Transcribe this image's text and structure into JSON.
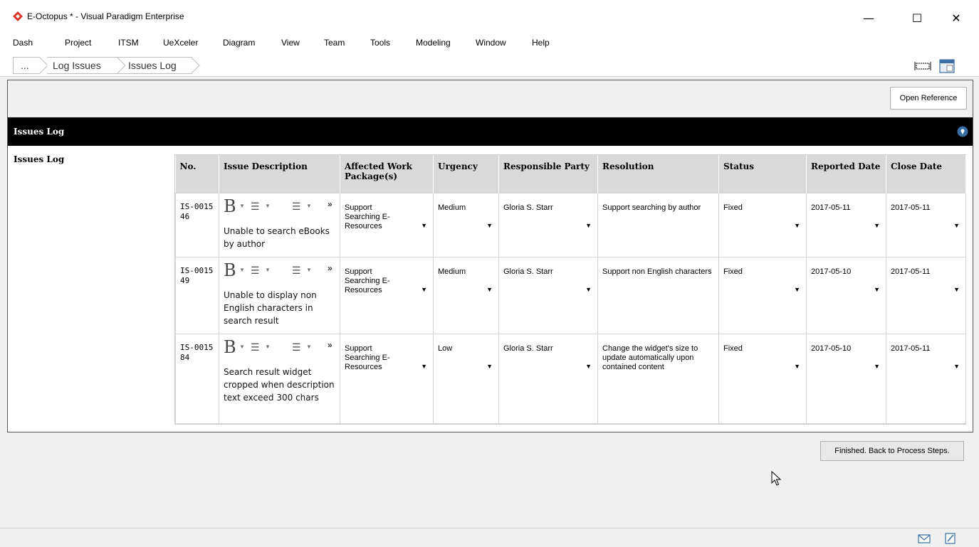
{
  "window": {
    "title": "E-Octopus * - Visual Paradigm Enterprise",
    "controls": {
      "minimize": "—",
      "maximize": "☐",
      "close": "✕"
    }
  },
  "menu": [
    "Dash",
    "Project",
    "ITSM",
    "UeXceler",
    "Diagram",
    "View",
    "Team",
    "Tools",
    "Modeling",
    "Window",
    "Help"
  ],
  "breadcrumb": [
    "...",
    "Log Issues",
    "Issues Log"
  ],
  "toolbar": {
    "open_reference": "Open Reference"
  },
  "section": {
    "title": "Issues Log",
    "side_label": "Issues Log"
  },
  "table": {
    "headers": {
      "no": "No.",
      "description": "Issue Description",
      "affected": "Affected Work Package(s)",
      "urgency": "Urgency",
      "responsible": "Responsible Party",
      "resolution": "Resolution",
      "status": "Status",
      "reported": "Reported Date",
      "close": "Close Date"
    },
    "rows": [
      {
        "no": "IS-0015 46",
        "description": "Unable to search eBooks by author",
        "affected": "Support Searching E-Resources",
        "urgency": "Medium",
        "responsible": "Gloria S. Starr",
        "resolution": "Support searching by author",
        "status": "Fixed",
        "reported": "2017-05-11",
        "close": "2017-05-11"
      },
      {
        "no": "IS-0015 49",
        "description": "Unable to display non English characters in search result",
        "affected": "Support Searching E-Resources",
        "urgency": "Medium",
        "responsible": "Gloria S. Starr",
        "resolution": "Support non English characters",
        "status": "Fixed",
        "reported": "2017-05-10",
        "close": "2017-05-11"
      },
      {
        "no": "IS-0015 84",
        "description": "Search result widget cropped when description text exceed 300 chars",
        "affected": "Support Searching E-Resources",
        "urgency": "Low",
        "responsible": "Gloria S. Starr",
        "resolution": "Change the widget's size to update automatically upon contained content",
        "status": "Fixed",
        "reported": "2017-05-10",
        "close": "2017-05-11"
      }
    ]
  },
  "footer": {
    "finished_button": "Finished. Back to Process Steps."
  },
  "colors": {
    "brand_logo": "#d9342b",
    "section_bar": "#000000",
    "header_bg": "#d9d9d9",
    "pin": "#3a6ea5"
  },
  "icons": [
    "app-logo-icon",
    "fit-diagram-icon",
    "panel-icon",
    "pin-icon",
    "dropdown-arrow-icon",
    "bold-icon",
    "align-icon",
    "list-icon",
    "more-icon",
    "mail-icon",
    "edit-icon",
    "mouse-cursor-icon"
  ]
}
